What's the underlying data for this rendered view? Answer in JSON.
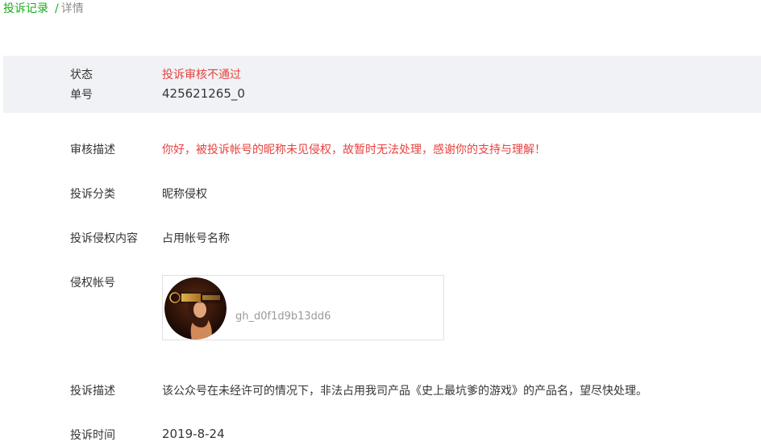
{
  "breadcrumb": {
    "parent": "投诉记录",
    "separator": "/",
    "current": "详情"
  },
  "status": {
    "status_label": "状态",
    "status_value": "投诉审核不通过",
    "number_label": "单号",
    "number_value": "425621265_0"
  },
  "details": {
    "review_label": "审核描述",
    "review_value": "你好，被投诉帐号的昵称未见侵权，故暂时无法处理，感谢你的支持与理解！",
    "category_label": "投诉分类",
    "category_value": "昵称侵权",
    "content_label": "投诉侵权内容",
    "content_value": "占用帐号名称",
    "account_label": "侵权帐号",
    "account_id": "gh_d0f1d9b13dd6",
    "description_label": "投诉描述",
    "description_value": "该公众号在未经许可的情况下，非法占用我司产品《史上最坑爹的游戏》的产品名，望尽快处理。",
    "time_label": "投诉时间",
    "time_value": "2019-8-24"
  },
  "colors": {
    "accent_green": "#1aad19",
    "error_red": "#e64340",
    "panel_bg": "#f1f2f5"
  }
}
